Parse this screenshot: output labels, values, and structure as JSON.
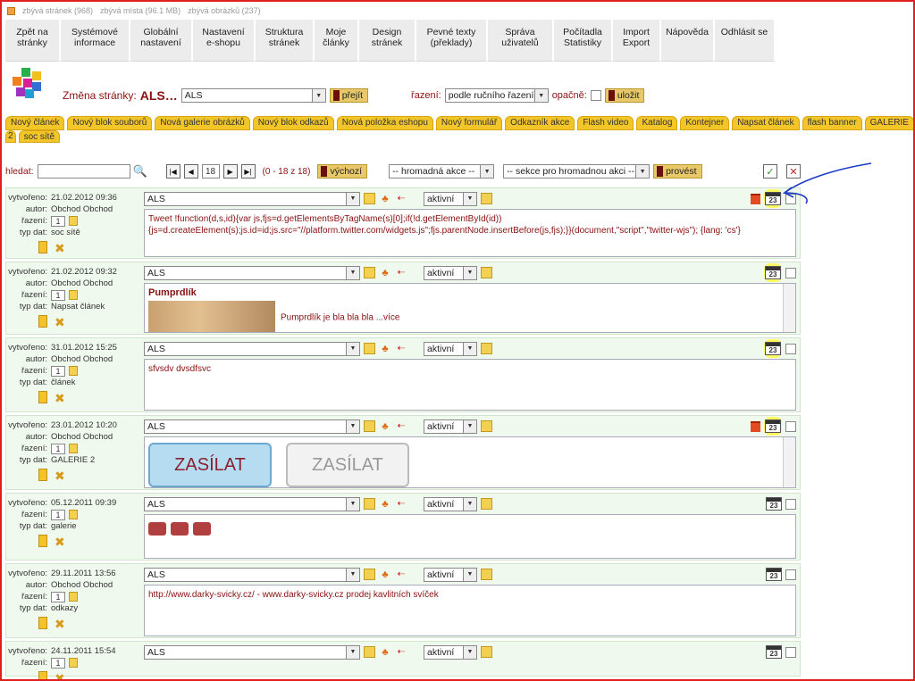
{
  "topbar": {
    "pages": "zbývá stránek (968)",
    "space": "zbývá místa (96.1 MB)",
    "images": "zbývá obrázků (237)"
  },
  "nav": [
    {
      "label": "Zpět na\nstránky",
      "w": 62
    },
    {
      "label": "Systémové\ninformace",
      "w": 78
    },
    {
      "label": "Globální\nnastavení",
      "w": 70
    },
    {
      "label": "Nastavení\ne-shopu",
      "w": 70
    },
    {
      "label": "Struktura\nstránek",
      "w": 66
    },
    {
      "label": "Moje\nčlánky",
      "w": 50
    },
    {
      "label": "Design\nstránek",
      "w": 64
    },
    {
      "label": "Pevné texty\n(překlady)",
      "w": 80
    },
    {
      "label": "Správa\nuživatelů",
      "w": 74
    },
    {
      "label": "Počítadla\nStatistiky",
      "w": 66
    },
    {
      "label": "Import\nExport",
      "w": 54
    },
    {
      "label": "Nápověda",
      "w": 60
    },
    {
      "label": "Odhlásit se",
      "w": 68
    }
  ],
  "pagesel": {
    "label": "Změna stránky:",
    "current": "ALS…",
    "value": "ALS",
    "go": "přejít",
    "sort_label": "řazení:",
    "sort_value": "podle ručního řazení",
    "reverse": "opačně:",
    "save": "uložit"
  },
  "tabs1": [
    "Nový článek",
    "Nový blok souborů",
    "Nová galerie obrázků",
    "Nový blok odkazů",
    "Nová položka eshopu",
    "Nový formulář",
    "Odkazník akce",
    "Flash video",
    "Katalog",
    "Kontejner",
    "Napsat článek",
    "flash banner",
    "GALERIE"
  ],
  "tabs2": [
    "2",
    "soc sítě"
  ],
  "toolbar": {
    "search_label": "hledat:",
    "search_value": "",
    "page": "18",
    "range": "(0 - 18 z 18)",
    "default": "výchozí",
    "mass_action": "-- hromadná akce --",
    "section": "-- sekce pro hromadnou akci --",
    "run": "provést"
  },
  "meta_labels": {
    "created": "vytvořeno:",
    "author": "autor:",
    "order": "řazení:",
    "type": "typ dat:"
  },
  "entries": [
    {
      "created": "21.02.2012 09:36",
      "author": "Obchod Obchod",
      "order": "1",
      "type": "soc sítě",
      "section": "ALS",
      "status": "aktivní",
      "cal": "23",
      "highlight": true,
      "del": true,
      "text": "Tweet  !function(d,s,id){var  js,fjs=d.getElementsByTagName(s)[0];if(!d.getElementById(id)){js=d.createElement(s);js.id=id;js.src=\"//platform.twitter.com/widgets.js\";fjs.parentNode.insertBefore(js,fjs);}}(document,\"script\",\"twitter-wjs\"); {lang: 'cs'}"
    },
    {
      "created": "21.02.2012 09:32",
      "author": "Obchod Obchod",
      "order": "1",
      "type": "Napsat článek",
      "section": "ALS",
      "status": "aktivní",
      "cal": "23",
      "highlight": true,
      "del": false,
      "title": "Pumprdlík",
      "text": "Pumprdlík je bla bla bla ...více"
    },
    {
      "created": "31.01.2012 15:25",
      "author": "Obchod Obchod",
      "order": "1",
      "type": "článek",
      "section": "ALS",
      "status": "aktivní",
      "cal": "23",
      "highlight": true,
      "del": false,
      "text": "sfvsdv dvsdfsvc"
    },
    {
      "created": "23.01.2012 10:20",
      "author": "Obchod Obchod",
      "order": "1",
      "type": "GALERIE 2",
      "section": "ALS",
      "status": "aktivní",
      "cal": "23",
      "highlight": true,
      "del": true,
      "z1": "ZASÍLAT",
      "z2": "ZASÍLAT"
    },
    {
      "created": "05.12.2011 09:39",
      "author": "",
      "order": "1",
      "type": "galerie",
      "section": "ALS",
      "status": "aktivní",
      "cal": "23",
      "highlight": false,
      "del": false
    },
    {
      "created": "29.11.2011 13:56",
      "author": "Obchod Obchod",
      "order": "1",
      "type": "odkazy",
      "section": "ALS",
      "status": "aktivní",
      "cal": "23",
      "highlight": false,
      "del": false,
      "text": "http://www.darky-svicky.cz/ - www.darky-svicky.cz prodej kavlitních svíček"
    },
    {
      "created": "24.11.2011 15:54",
      "author": "",
      "order": "1",
      "type": "",
      "section": "ALS",
      "status": "aktivní",
      "cal": "23",
      "highlight": false,
      "del": false
    }
  ],
  "colors": {
    "accent": "#8a1010",
    "tab": "#f2c629",
    "entry_bg": "#f0f9ee",
    "frame": "#e02020",
    "pen": "#1a3cc8"
  }
}
